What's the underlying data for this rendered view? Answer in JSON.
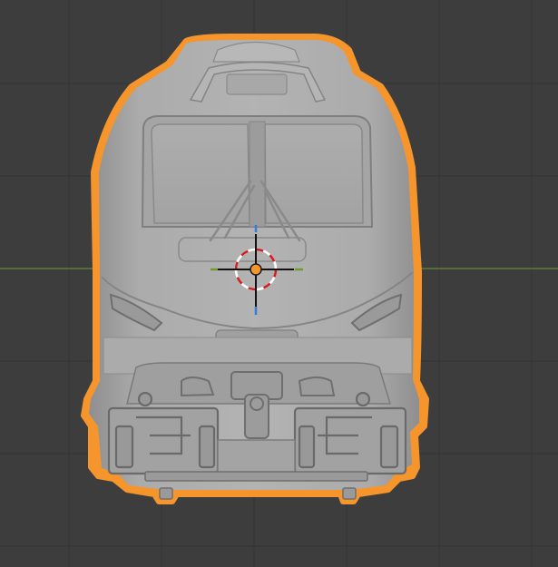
{
  "viewport": {
    "view": "front-orthographic",
    "background": "#3d3d3d",
    "grid_color": "#333333",
    "x_axis_color": "#6e9a2e"
  },
  "model": {
    "object": "locomotive",
    "selected": true,
    "surface_color": "#a6a6a6",
    "selection_outline_color": "#f5952c"
  },
  "cursor_3d": {
    "icon": "3d-cursor-icon",
    "ring_colors": [
      "#d11f1f",
      "#ffffff"
    ]
  },
  "origin": {
    "icon": "object-origin-dot",
    "color": "#f5952c"
  },
  "gizmo": {
    "y_axis_color": "#3a7bd5",
    "x_axis_color": "#6e9a2e",
    "z_axis_color": "#111111"
  }
}
